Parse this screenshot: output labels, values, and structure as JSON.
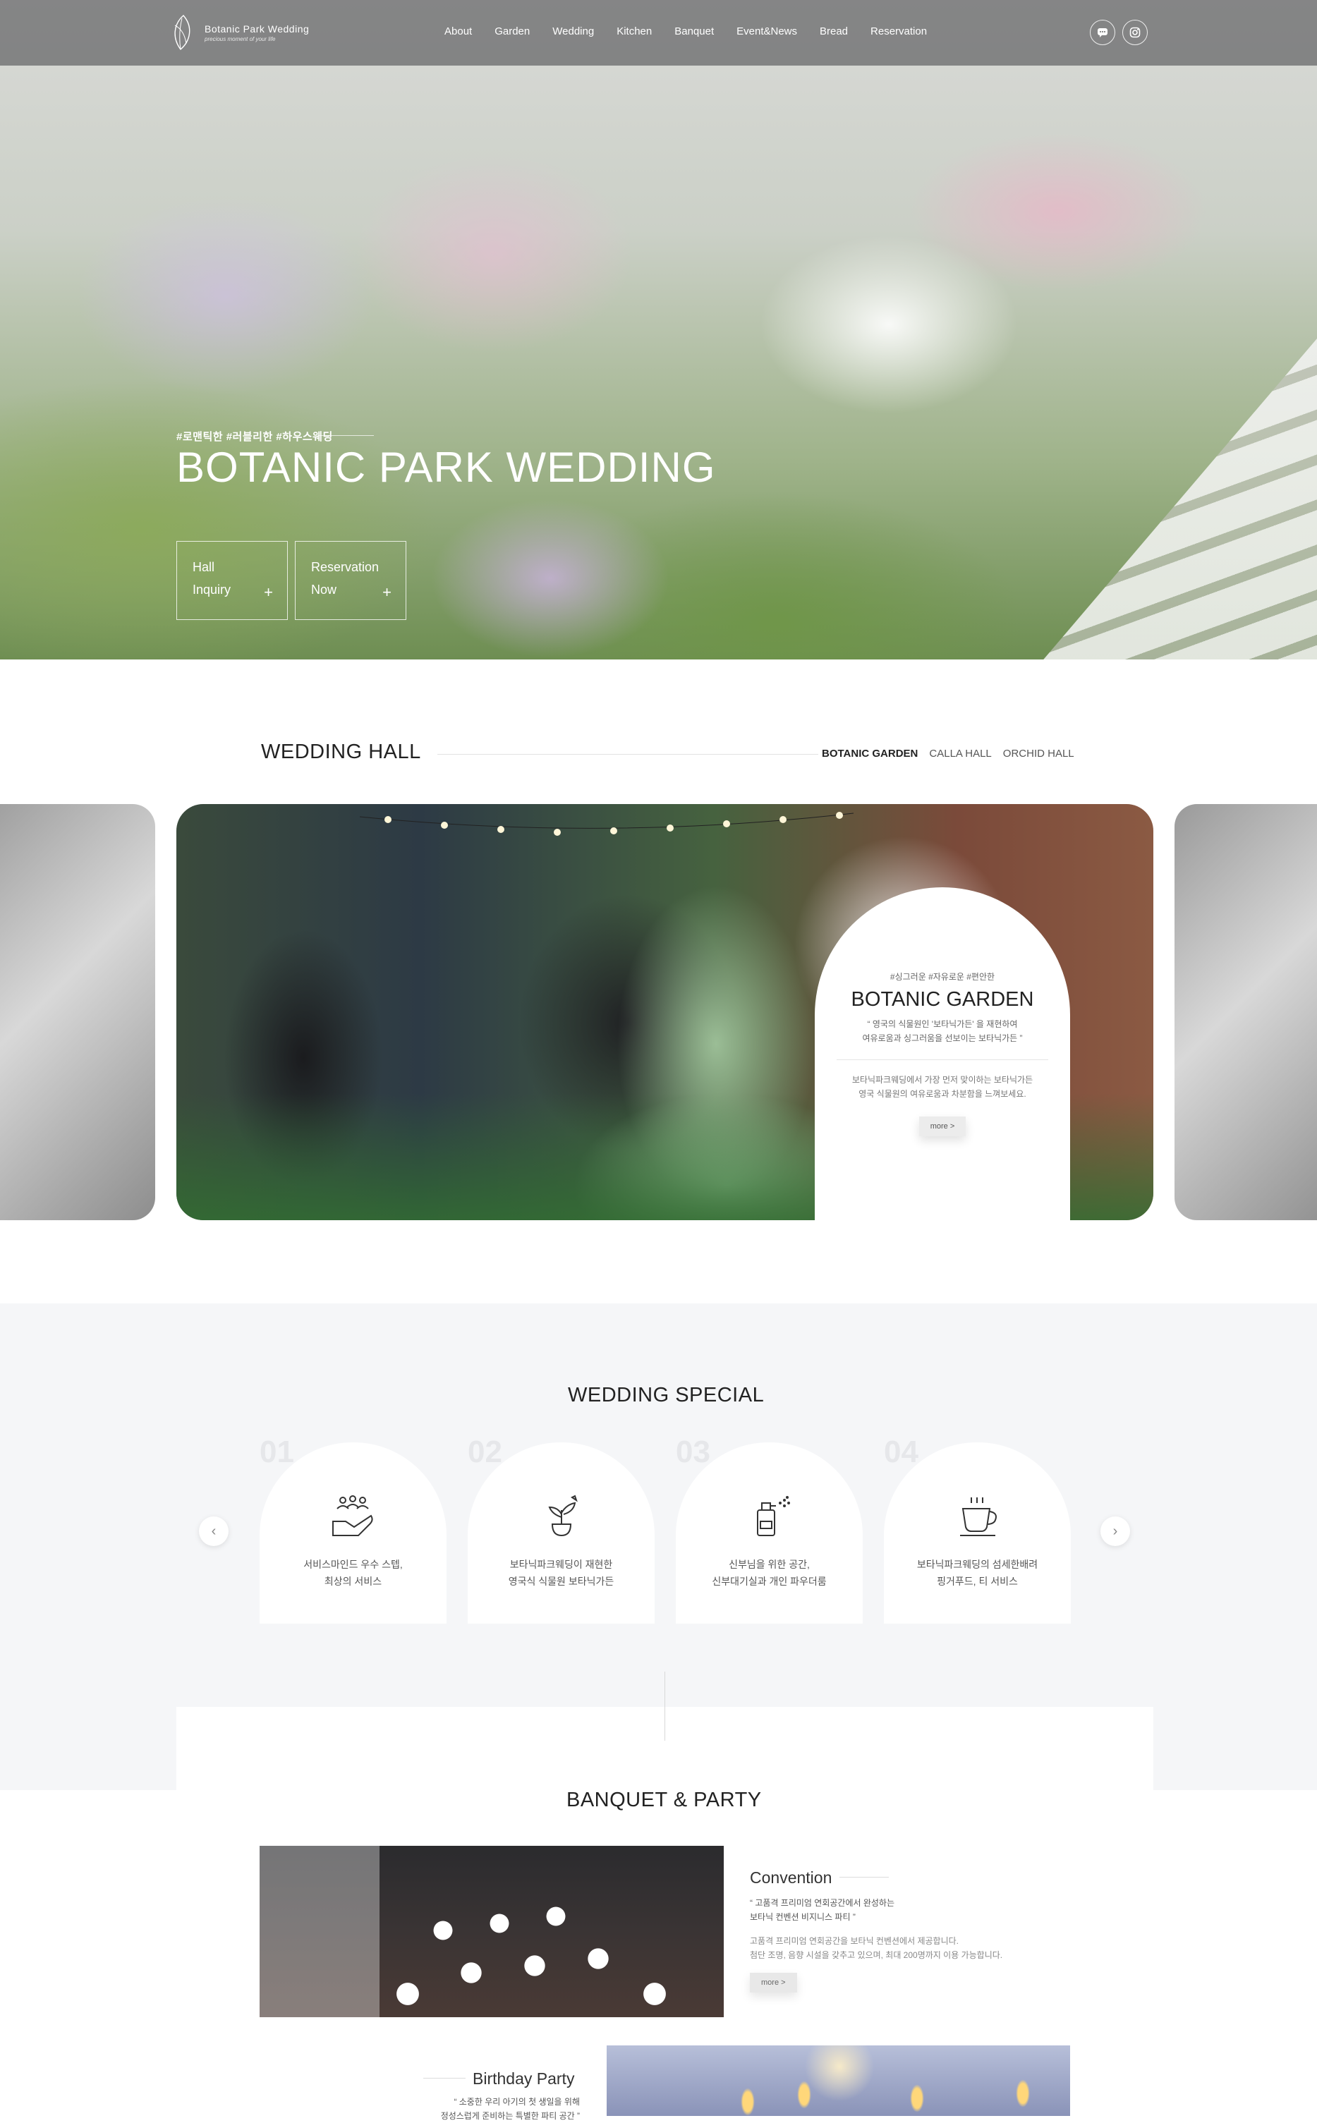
{
  "brand": {
    "name": "Botanic Park Wedding",
    "tagline": "precious moment of your life"
  },
  "nav": [
    "About",
    "Garden",
    "Wedding",
    "Kitchen",
    "Banquet",
    "Event&News",
    "Bread",
    "Reservation"
  ],
  "header_icons": [
    "chat-icon",
    "instagram-icon"
  ],
  "hero": {
    "tags": "#로맨틱한 #러블리한 #하우스웨딩",
    "title": "BOTANIC PARK WEDDING",
    "buttons": [
      {
        "line1": "Hall",
        "line2": "Inquiry",
        "icon": "+"
      },
      {
        "line1": "Reservation",
        "line2": "Now",
        "icon": "+"
      }
    ]
  },
  "wedding_hall": {
    "title": "WEDDING HALL",
    "tabs": [
      "BOTANIC GARDEN",
      "CALLA HALL",
      "ORCHID HALL"
    ],
    "active_tab": "BOTANIC GARDEN",
    "card": {
      "tags": "#싱그러운 #자유로운 #편안한",
      "name": "BOTANIC GARDEN",
      "quote1": "“ 영국의 식물원인 '보타닉가든' 을 재현하여",
      "quote2": "여유로움과 싱그러움을 선보이는 보타닉가든 ”",
      "desc1": "보타닉파크웨딩에서 가장 먼저 맞이하는 보타닉가든",
      "desc2": "영국 식물원의 여유로움과 차분함을 느껴보세요.",
      "more": "more >"
    }
  },
  "wedding_special": {
    "title": "WEDDING SPECIAL",
    "prev": "‹",
    "next": "›",
    "items": [
      {
        "num": "01",
        "icon": "service-hand-icon",
        "line1": "서비스마인드 우수 스텝,",
        "line2": "최상의 서비스"
      },
      {
        "num": "02",
        "icon": "plant-icon",
        "line1": "보타닉파크웨딩이 재현한",
        "line2": "영국식 식물원 보타닉가든"
      },
      {
        "num": "03",
        "icon": "perfume-icon",
        "line1": "신부님을 위한 공간,",
        "line2": "신부대기실과 개인 파우더룸"
      },
      {
        "num": "04",
        "icon": "coffee-cup-icon",
        "line1": "보타닉파크웨딩의 섬세한배려",
        "line2": "핑거푸드, 티 서비스"
      }
    ]
  },
  "banquet": {
    "title": "BANQUET & PARTY",
    "convention": {
      "title": "Convention",
      "quote1": "“ 고품격 프리미엄 연회공간에서 완성하는",
      "quote2": "보타닉 컨벤션 비지니스 파티 ”",
      "desc1": "고품격 프리미엄 연회공간을 보타닉 컨벤션에서 제공합니다.",
      "desc2": "첨단 조명, 음향 시설을 갖추고 있으며, 최대 200명까지 이용 가능합니다.",
      "more": "more >"
    },
    "party": {
      "title": "Birthday Party",
      "quote1": "“ 소중한 우리 아기의 첫 생일을 위해",
      "quote2": "정성스럽게 준비하는 특별한 파티 공간 ”"
    }
  }
}
